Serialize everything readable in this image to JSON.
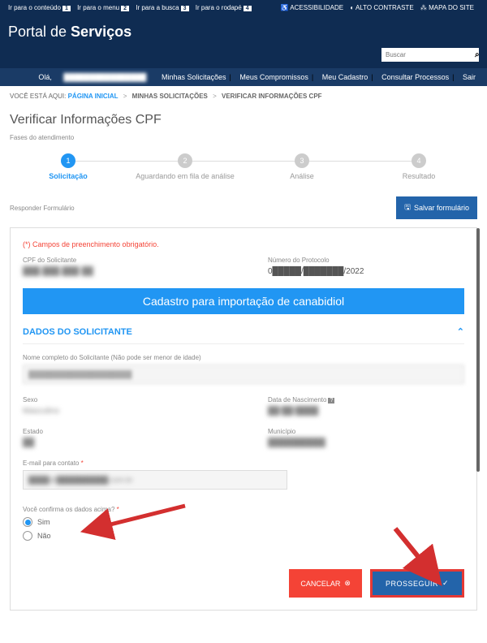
{
  "skiplinks": {
    "content": "Ir para o conteúdo",
    "menu": "Ir para o menu",
    "busca": "Ir para a busca",
    "rodape": "Ir para o rodapé"
  },
  "accessibility": {
    "acess": "ACESSIBILIDADE",
    "contrast": "ALTO CONTRASTE",
    "map": "MAPA DO SITE"
  },
  "logo": {
    "part1": "Portal de ",
    "part2": "Serviços"
  },
  "search": {
    "placeholder": "Buscar"
  },
  "menu": {
    "greeting": "Olá, ",
    "user": "████████████████",
    "items": [
      "Minhas Solicitações",
      "Meus Compromissos",
      "Meu Cadastro",
      "Consultar Processos",
      "Sair"
    ]
  },
  "breadcrumb": {
    "label": "VOCÊ ESTÁ AQUI:",
    "home": "PÁGINA INICIAL",
    "c1": "MINHAS SOLICITAÇÕES",
    "c2": "VERIFICAR INFORMAÇÕES CPF"
  },
  "title": "Verificar Informações CPF",
  "fases": "Fases do atendimento",
  "steps": [
    {
      "n": "1",
      "label": "Solicitação"
    },
    {
      "n": "2",
      "label": "Aguardando em fila de análise"
    },
    {
      "n": "3",
      "label": "Análise"
    },
    {
      "n": "4",
      "label": "Resultado"
    }
  ],
  "form_header": "Responder Formulário",
  "save_btn": "Salvar formulário",
  "required_note": "(*) Campos de preenchimento obrigatório.",
  "cpf": {
    "label": "CPF do Solicitante",
    "value": "███.███.███-██"
  },
  "protocolo": {
    "label": "Número do Protocolo",
    "value": "0█████/███████/2022"
  },
  "banner": "Cadastro para importação de canabidiol",
  "section": "DADOS DO SOLICITANTE",
  "nome": {
    "label": "Nome completo do Solicitante (Não pode ser menor de idade)",
    "value": "████████████████████"
  },
  "sexo": {
    "label": "Sexo",
    "value": "Masculino"
  },
  "nascimento": {
    "label": "Data de Nascimento",
    "value": "██/██/████"
  },
  "estado": {
    "label": "Estado",
    "value": "██"
  },
  "municipio": {
    "label": "Município",
    "value": "██████████"
  },
  "email": {
    "label": "E-mail para contato",
    "value": "████@██████████.com.br"
  },
  "confirm": {
    "label": "Você confirma os dados acima?",
    "sim": "Sim",
    "nao": "Não"
  },
  "cancel": "CANCELAR",
  "proceed": "PROSSEGUIR"
}
